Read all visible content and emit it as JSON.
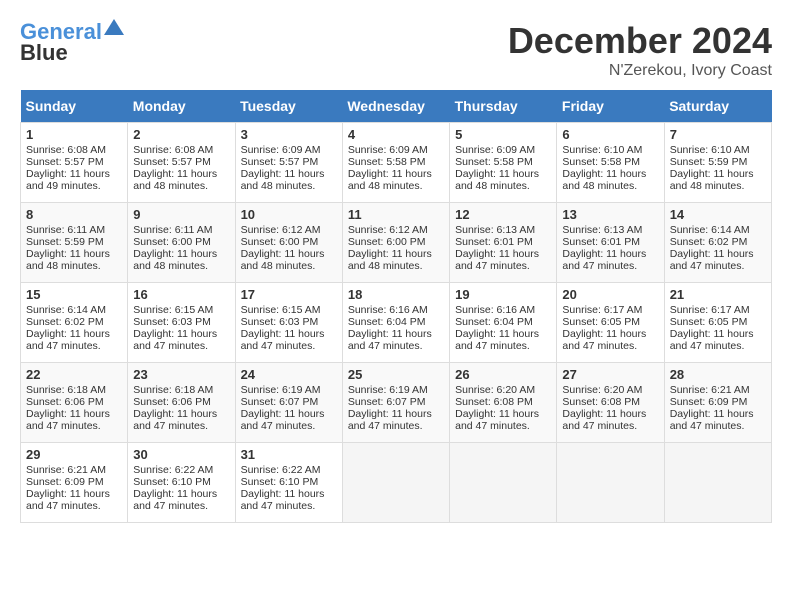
{
  "header": {
    "logo_line1": "General",
    "logo_line2": "Blue",
    "month": "December 2024",
    "location": "N'Zerekou, Ivory Coast"
  },
  "days_of_week": [
    "Sunday",
    "Monday",
    "Tuesday",
    "Wednesday",
    "Thursday",
    "Friday",
    "Saturday"
  ],
  "weeks": [
    [
      {
        "day": "1",
        "sunrise": "6:08 AM",
        "sunset": "5:57 PM",
        "daylight": "11 hours and 49 minutes."
      },
      {
        "day": "2",
        "sunrise": "6:08 AM",
        "sunset": "5:57 PM",
        "daylight": "11 hours and 48 minutes."
      },
      {
        "day": "3",
        "sunrise": "6:09 AM",
        "sunset": "5:57 PM",
        "daylight": "11 hours and 48 minutes."
      },
      {
        "day": "4",
        "sunrise": "6:09 AM",
        "sunset": "5:58 PM",
        "daylight": "11 hours and 48 minutes."
      },
      {
        "day": "5",
        "sunrise": "6:09 AM",
        "sunset": "5:58 PM",
        "daylight": "11 hours and 48 minutes."
      },
      {
        "day": "6",
        "sunrise": "6:10 AM",
        "sunset": "5:58 PM",
        "daylight": "11 hours and 48 minutes."
      },
      {
        "day": "7",
        "sunrise": "6:10 AM",
        "sunset": "5:59 PM",
        "daylight": "11 hours and 48 minutes."
      }
    ],
    [
      {
        "day": "8",
        "sunrise": "6:11 AM",
        "sunset": "5:59 PM",
        "daylight": "11 hours and 48 minutes."
      },
      {
        "day": "9",
        "sunrise": "6:11 AM",
        "sunset": "6:00 PM",
        "daylight": "11 hours and 48 minutes."
      },
      {
        "day": "10",
        "sunrise": "6:12 AM",
        "sunset": "6:00 PM",
        "daylight": "11 hours and 48 minutes."
      },
      {
        "day": "11",
        "sunrise": "6:12 AM",
        "sunset": "6:00 PM",
        "daylight": "11 hours and 48 minutes."
      },
      {
        "day": "12",
        "sunrise": "6:13 AM",
        "sunset": "6:01 PM",
        "daylight": "11 hours and 47 minutes."
      },
      {
        "day": "13",
        "sunrise": "6:13 AM",
        "sunset": "6:01 PM",
        "daylight": "11 hours and 47 minutes."
      },
      {
        "day": "14",
        "sunrise": "6:14 AM",
        "sunset": "6:02 PM",
        "daylight": "11 hours and 47 minutes."
      }
    ],
    [
      {
        "day": "15",
        "sunrise": "6:14 AM",
        "sunset": "6:02 PM",
        "daylight": "11 hours and 47 minutes."
      },
      {
        "day": "16",
        "sunrise": "6:15 AM",
        "sunset": "6:03 PM",
        "daylight": "11 hours and 47 minutes."
      },
      {
        "day": "17",
        "sunrise": "6:15 AM",
        "sunset": "6:03 PM",
        "daylight": "11 hours and 47 minutes."
      },
      {
        "day": "18",
        "sunrise": "6:16 AM",
        "sunset": "6:04 PM",
        "daylight": "11 hours and 47 minutes."
      },
      {
        "day": "19",
        "sunrise": "6:16 AM",
        "sunset": "6:04 PM",
        "daylight": "11 hours and 47 minutes."
      },
      {
        "day": "20",
        "sunrise": "6:17 AM",
        "sunset": "6:05 PM",
        "daylight": "11 hours and 47 minutes."
      },
      {
        "day": "21",
        "sunrise": "6:17 AM",
        "sunset": "6:05 PM",
        "daylight": "11 hours and 47 minutes."
      }
    ],
    [
      {
        "day": "22",
        "sunrise": "6:18 AM",
        "sunset": "6:06 PM",
        "daylight": "11 hours and 47 minutes."
      },
      {
        "day": "23",
        "sunrise": "6:18 AM",
        "sunset": "6:06 PM",
        "daylight": "11 hours and 47 minutes."
      },
      {
        "day": "24",
        "sunrise": "6:19 AM",
        "sunset": "6:07 PM",
        "daylight": "11 hours and 47 minutes."
      },
      {
        "day": "25",
        "sunrise": "6:19 AM",
        "sunset": "6:07 PM",
        "daylight": "11 hours and 47 minutes."
      },
      {
        "day": "26",
        "sunrise": "6:20 AM",
        "sunset": "6:08 PM",
        "daylight": "11 hours and 47 minutes."
      },
      {
        "day": "27",
        "sunrise": "6:20 AM",
        "sunset": "6:08 PM",
        "daylight": "11 hours and 47 minutes."
      },
      {
        "day": "28",
        "sunrise": "6:21 AM",
        "sunset": "6:09 PM",
        "daylight": "11 hours and 47 minutes."
      }
    ],
    [
      {
        "day": "29",
        "sunrise": "6:21 AM",
        "sunset": "6:09 PM",
        "daylight": "11 hours and 47 minutes."
      },
      {
        "day": "30",
        "sunrise": "6:22 AM",
        "sunset": "6:10 PM",
        "daylight": "11 hours and 47 minutes."
      },
      {
        "day": "31",
        "sunrise": "6:22 AM",
        "sunset": "6:10 PM",
        "daylight": "11 hours and 47 minutes."
      },
      null,
      null,
      null,
      null
    ]
  ]
}
